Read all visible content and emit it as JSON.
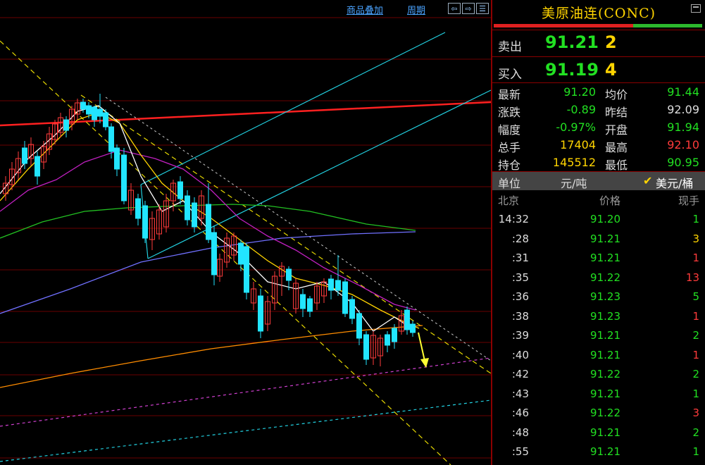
{
  "toolbar": {
    "overlay_label": "商品叠加",
    "period_label": "周期"
  },
  "panel": {
    "title": "美原油连(CONC)",
    "sell": {
      "label": "卖出",
      "price": "91.21",
      "volume": "2"
    },
    "buy": {
      "label": "买入",
      "price": "91.19",
      "volume": "4"
    },
    "stats": [
      {
        "label": "最新",
        "value": "91.20",
        "color": "#22e022",
        "label2": "均价",
        "value2": "91.44",
        "color2": "#22e022"
      },
      {
        "label": "涨跌",
        "value": "-0.89",
        "color": "#22e022",
        "label2": "昨结",
        "value2": "92.09",
        "color2": "#dddddd"
      },
      {
        "label": "幅度",
        "value": "-0.97%",
        "color": "#22e022",
        "label2": "开盘",
        "value2": "91.94",
        "color2": "#22e022"
      },
      {
        "label": "总手",
        "value": "17404",
        "color": "#ffd400",
        "label2": "最高",
        "value2": "92.10",
        "color2": "#ff3b3b"
      },
      {
        "label": "持仓",
        "value": "145512",
        "color": "#ffd400",
        "label2": "最低",
        "value2": "90.95",
        "color2": "#22e022"
      }
    ],
    "unit": {
      "label": "单位",
      "opt1": "元/吨",
      "check": "✔",
      "opt2": "美元/桶"
    },
    "ticks_header": {
      "time": "北京",
      "price": "价格",
      "volume": "现手"
    },
    "ticks": [
      {
        "time": "14:32",
        "price": "91.20",
        "vol": "1",
        "color": "#22e022"
      },
      {
        "time": ":28",
        "price": "91.21",
        "vol": "3",
        "color": "#ffd400"
      },
      {
        "time": ":31",
        "price": "91.21",
        "vol": "1",
        "color": "#ff3b3b"
      },
      {
        "time": ":35",
        "price": "91.22",
        "vol": "13",
        "color": "#ff3b3b"
      },
      {
        "time": ":36",
        "price": "91.23",
        "vol": "5",
        "color": "#22e022"
      },
      {
        "time": ":38",
        "price": "91.23",
        "vol": "1",
        "color": "#ff3b3b"
      },
      {
        "time": ":39",
        "price": "91.21",
        "vol": "2",
        "color": "#22e022"
      },
      {
        "time": ":40",
        "price": "91.21",
        "vol": "1",
        "color": "#ff3b3b"
      },
      {
        "time": ":42",
        "price": "91.22",
        "vol": "2",
        "color": "#22e022"
      },
      {
        "time": ":43",
        "price": "91.21",
        "vol": "1",
        "color": "#22e022"
      },
      {
        "time": ":46",
        "price": "91.22",
        "vol": "3",
        "color": "#ff3b3b"
      },
      {
        "time": ":48",
        "price": "91.21",
        "vol": "2",
        "color": "#22e022"
      },
      {
        "time": ":55",
        "price": "91.21",
        "vol": "1",
        "color": "#22e022"
      }
    ]
  },
  "chart_data": {
    "type": "candlestick",
    "title": "",
    "xlabel": "",
    "ylabel": "",
    "grid": true,
    "colors": {
      "up": "#ff3b3b",
      "down": "#22e5ff",
      "bg": "#000000"
    },
    "series": [
      {
        "name": "",
        "color": "#ffffff"
      },
      {
        "name": "",
        "color": "#ffd400"
      },
      {
        "name": "",
        "color": "#c020c0"
      },
      {
        "name": "",
        "color": "#22c022"
      },
      {
        "name": "",
        "color": "#7070ff"
      },
      {
        "name": "",
        "color": "#ff8c00"
      },
      {
        "name": "",
        "color": "#ff2020"
      }
    ]
  }
}
